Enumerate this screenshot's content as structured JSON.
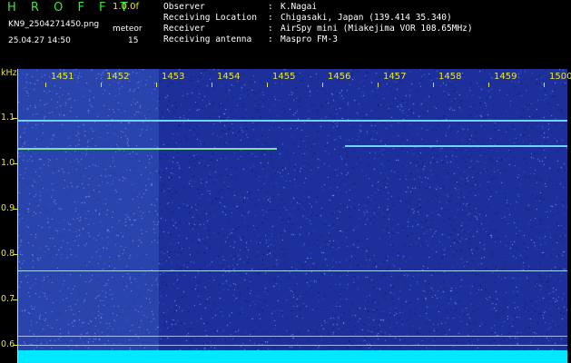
{
  "header": {
    "app_title": "H R O F F T",
    "version": "1.0.0f",
    "file_name": "KN9_2504271450.png",
    "datetime": "25.04.27 14:50",
    "meteor_label": "meteor",
    "meteor_count": "15"
  },
  "info": [
    {
      "key": "Observer",
      "value": "K.Nagai"
    },
    {
      "key": "Receiving Location",
      "value": "Chigasaki, Japan (139.414 35.340)"
    },
    {
      "key": "Receiver",
      "value": "AirSpy mini (Miakejima VOR 108.65MHz)"
    },
    {
      "key": "Receiving antenna",
      "value": "Maspro FM-3"
    }
  ],
  "axis": {
    "y_unit": "kHz",
    "x_ticks": [
      "1451",
      "1452",
      "1453",
      "1454",
      "1455",
      "1456",
      "1457",
      "1458",
      "1459",
      "1500"
    ],
    "y_ticks": [
      "1.1",
      "1.0",
      "0.9",
      "0.8",
      "0.7",
      "0.6"
    ]
  },
  "colors": {
    "background": "#000000",
    "title_green": "#39e639",
    "label_yellow": "#e6e63a",
    "spectrum_blue": "#1d2f9a",
    "signal_cyan": "#00e8ff"
  }
}
